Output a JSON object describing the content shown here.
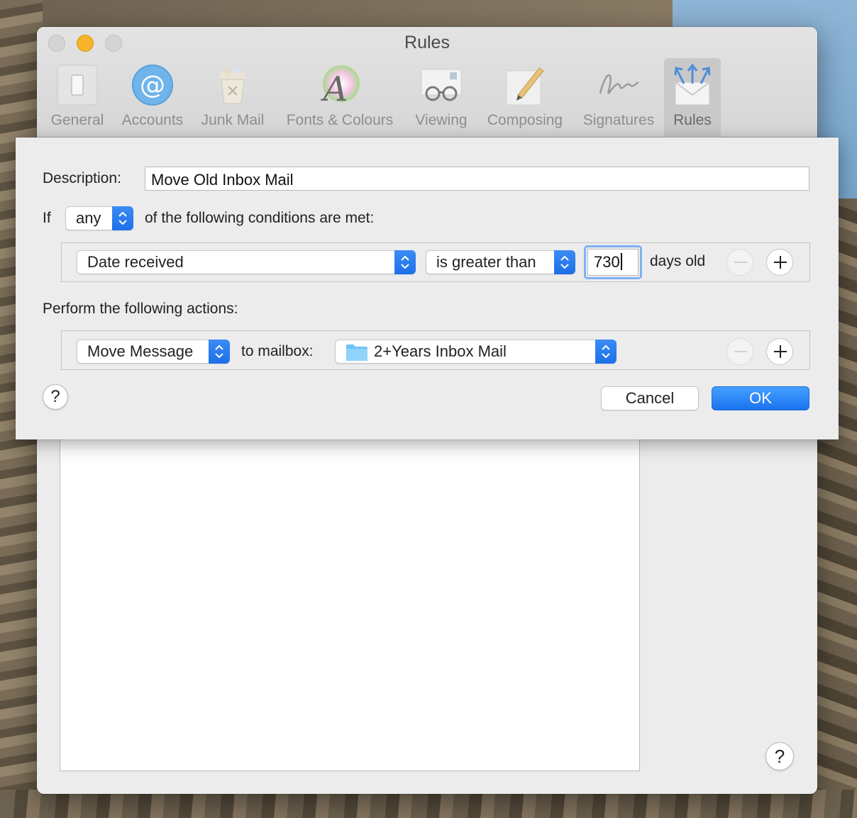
{
  "window": {
    "title": "Rules"
  },
  "toolbar": {
    "items": [
      {
        "label": "General",
        "icon": "switch-icon"
      },
      {
        "label": "Accounts",
        "icon": "at-sign-icon"
      },
      {
        "label": "Junk Mail",
        "icon": "trash-bin-icon"
      },
      {
        "label": "Fonts & Colours",
        "icon": "font-colour-icon"
      },
      {
        "label": "Viewing",
        "icon": "glasses-envelope-icon"
      },
      {
        "label": "Composing",
        "icon": "pencil-paper-icon"
      },
      {
        "label": "Signatures",
        "icon": "signature-icon"
      },
      {
        "label": "Rules",
        "icon": "rules-envelope-icon"
      }
    ],
    "selected": "Rules"
  },
  "sheet": {
    "description_label": "Description:",
    "description_value": "Move Old Inbox Mail",
    "if_label": "If",
    "match_popup": "any",
    "conditions_suffix": "of the following conditions are met:",
    "condition": {
      "field": "Date received",
      "operator": "is greater than",
      "value": "730",
      "unit": "days old"
    },
    "actions_label": "Perform the following actions:",
    "action": {
      "type": "Move Message",
      "connector": "to mailbox:",
      "mailbox": "2+Years Inbox Mail"
    },
    "help_label": "?",
    "cancel_label": "Cancel",
    "ok_label": "OK"
  },
  "window_help_label": "?",
  "colors": {
    "accent": "#1a73ee",
    "folder": "#6ec3f7",
    "window_bg": "#ececec"
  }
}
